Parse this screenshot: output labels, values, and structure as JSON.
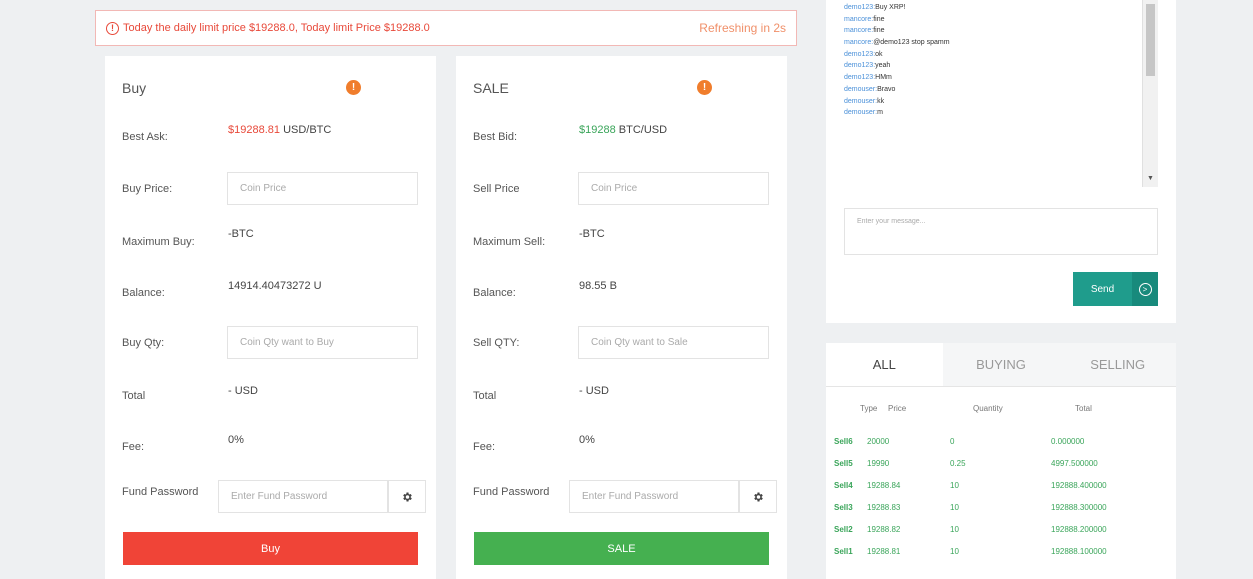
{
  "alert": {
    "message": "Today the daily limit price $19288.0, Today limit Price $19288.0",
    "refresh": "Refreshing in 2s"
  },
  "buy": {
    "title": "Buy",
    "best_ask_label": "Best Ask:",
    "best_ask_value": "$19288.81",
    "best_ask_unit": "USD/BTC",
    "price_label": "Buy Price:",
    "price_placeholder": "Coin Price",
    "max_label": "Maximum Buy:",
    "max_value": "-BTC",
    "balance_label": "Balance:",
    "balance_value": "14914.40473272 U",
    "qty_label": "Buy Qty:",
    "qty_placeholder": "Coin Qty want to Buy",
    "total_label": "Total",
    "total_value": "- USD",
    "fee_label": "Fee:",
    "fee_value": "0%",
    "fund_label": "Fund Password",
    "fund_placeholder": "Enter Fund Password",
    "button": "Buy"
  },
  "sale": {
    "title": "SALE",
    "best_bid_label": "Best Bid:",
    "best_bid_value": "$19288",
    "best_bid_unit": "BTC/USD",
    "price_label": "Sell Price",
    "price_placeholder": "Coin Price",
    "max_label": "Maximum Sell:",
    "max_value": "-BTC",
    "balance_label": "Balance:",
    "balance_value": "98.55 B",
    "qty_label": "Sell QTY:",
    "qty_placeholder": "Coin Qty want to Sale",
    "total_label": "Total",
    "total_value": "- USD",
    "fee_label": "Fee:",
    "fee_value": "0%",
    "fund_label": "Fund Password",
    "fund_placeholder": "Enter Fund Password",
    "button": "SALE"
  },
  "chat": {
    "lines": [
      {
        "user": "demo123:",
        "text": "Buy XRP!"
      },
      {
        "user": "mancore:",
        "text": "fine"
      },
      {
        "user": "mancore:",
        "text": "fine"
      },
      {
        "user": "mancore:",
        "text": "@demo123 stop spamm"
      },
      {
        "user": "demo123:",
        "text": "ok"
      },
      {
        "user": "demo123:",
        "text": "yeah"
      },
      {
        "user": "demo123:",
        "text": "HMm"
      },
      {
        "user": "demouser:",
        "text": "Bravo"
      },
      {
        "user": "demouser:",
        "text": "kk"
      },
      {
        "user": "demouser:",
        "text": "m"
      }
    ],
    "message_placeholder": "Enter your message...",
    "send_label": "Send"
  },
  "orders": {
    "tabs": [
      "ALL",
      "BUYING",
      "SELLING"
    ],
    "headers": {
      "type": "Type",
      "price": "Price",
      "quantity": "Quantity",
      "total": "Total"
    },
    "rows": [
      {
        "type": "Sell6",
        "price": "20000",
        "qty": "0",
        "total": "0.000000"
      },
      {
        "type": "Sell5",
        "price": "19990",
        "qty": "0.25",
        "total": "4997.500000"
      },
      {
        "type": "Sell4",
        "price": "19288.84",
        "qty": "10",
        "total": "192888.400000"
      },
      {
        "type": "Sell3",
        "price": "19288.83",
        "qty": "10",
        "total": "192888.300000"
      },
      {
        "type": "Sell2",
        "price": "19288.82",
        "qty": "10",
        "total": "192888.200000"
      },
      {
        "type": "Sell1",
        "price": "19288.81",
        "qty": "10",
        "total": "192888.100000"
      }
    ]
  },
  "colors": {
    "buy_button": "#f04437",
    "sale_button": "#45b050",
    "info_icon": "#f07d2c",
    "send_button": "#1f9c8c",
    "order_green": "#3aa55a"
  },
  "icons": {
    "alert": "alert-circle-icon",
    "info": "info-icon",
    "gear": "gear-icon",
    "send": "arrow-circle-right-icon"
  }
}
